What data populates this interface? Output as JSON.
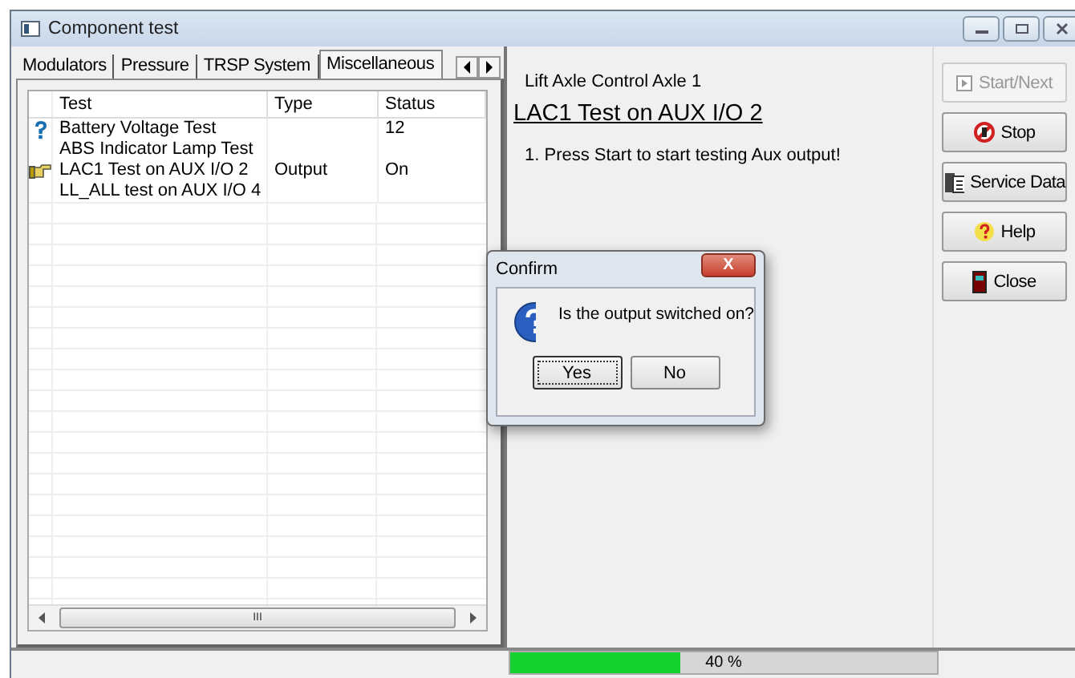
{
  "window": {
    "title": "Component test"
  },
  "tabs": [
    {
      "label": "Modulators",
      "selected": false
    },
    {
      "label": "Pressure",
      "selected": false
    },
    {
      "label": "TRSP System",
      "selected": false
    },
    {
      "label": "Miscellaneous",
      "selected": true
    }
  ],
  "table": {
    "columns": [
      "Test",
      "Type",
      "Status"
    ],
    "rows": [
      {
        "kind": "question",
        "cells": [
          "Battery Voltage Test",
          "",
          "12"
        ]
      },
      {
        "kind": "none",
        "cells": [
          "ABS Indicator Lamp Test",
          "",
          ""
        ]
      },
      {
        "kind": "pointer",
        "cells": [
          "LAC1 Test on AUX I/O 2",
          "Output",
          "On"
        ]
      },
      {
        "kind": "none",
        "cells": [
          "LL_ALL test on AUX I/O 4",
          "",
          ""
        ]
      }
    ],
    "scroll_grip": "III"
  },
  "content": {
    "group": "Lift Axle Control Axle 1",
    "heading": "LAC1 Test on AUX I/O 2",
    "instruction": "1. Press Start to start testing Aux output!"
  },
  "buttons": [
    {
      "kind": "play",
      "label": "Start/Next",
      "disabled": true
    },
    {
      "kind": "stop",
      "label": "Stop",
      "disabled": false
    },
    {
      "kind": "book",
      "label": "Service Data",
      "disabled": false
    },
    {
      "kind": "help",
      "label": "Help",
      "disabled": false
    },
    {
      "kind": "door",
      "label": "Close",
      "disabled": false
    }
  ],
  "dialog": {
    "title": "Confirm",
    "close": "X",
    "message": "Is the output switched on?",
    "buttons": [
      {
        "label": "Yes",
        "default": true
      },
      {
        "label": "No",
        "default": false
      }
    ]
  },
  "progress": {
    "level": 0.4,
    "reading": "40 %"
  }
}
